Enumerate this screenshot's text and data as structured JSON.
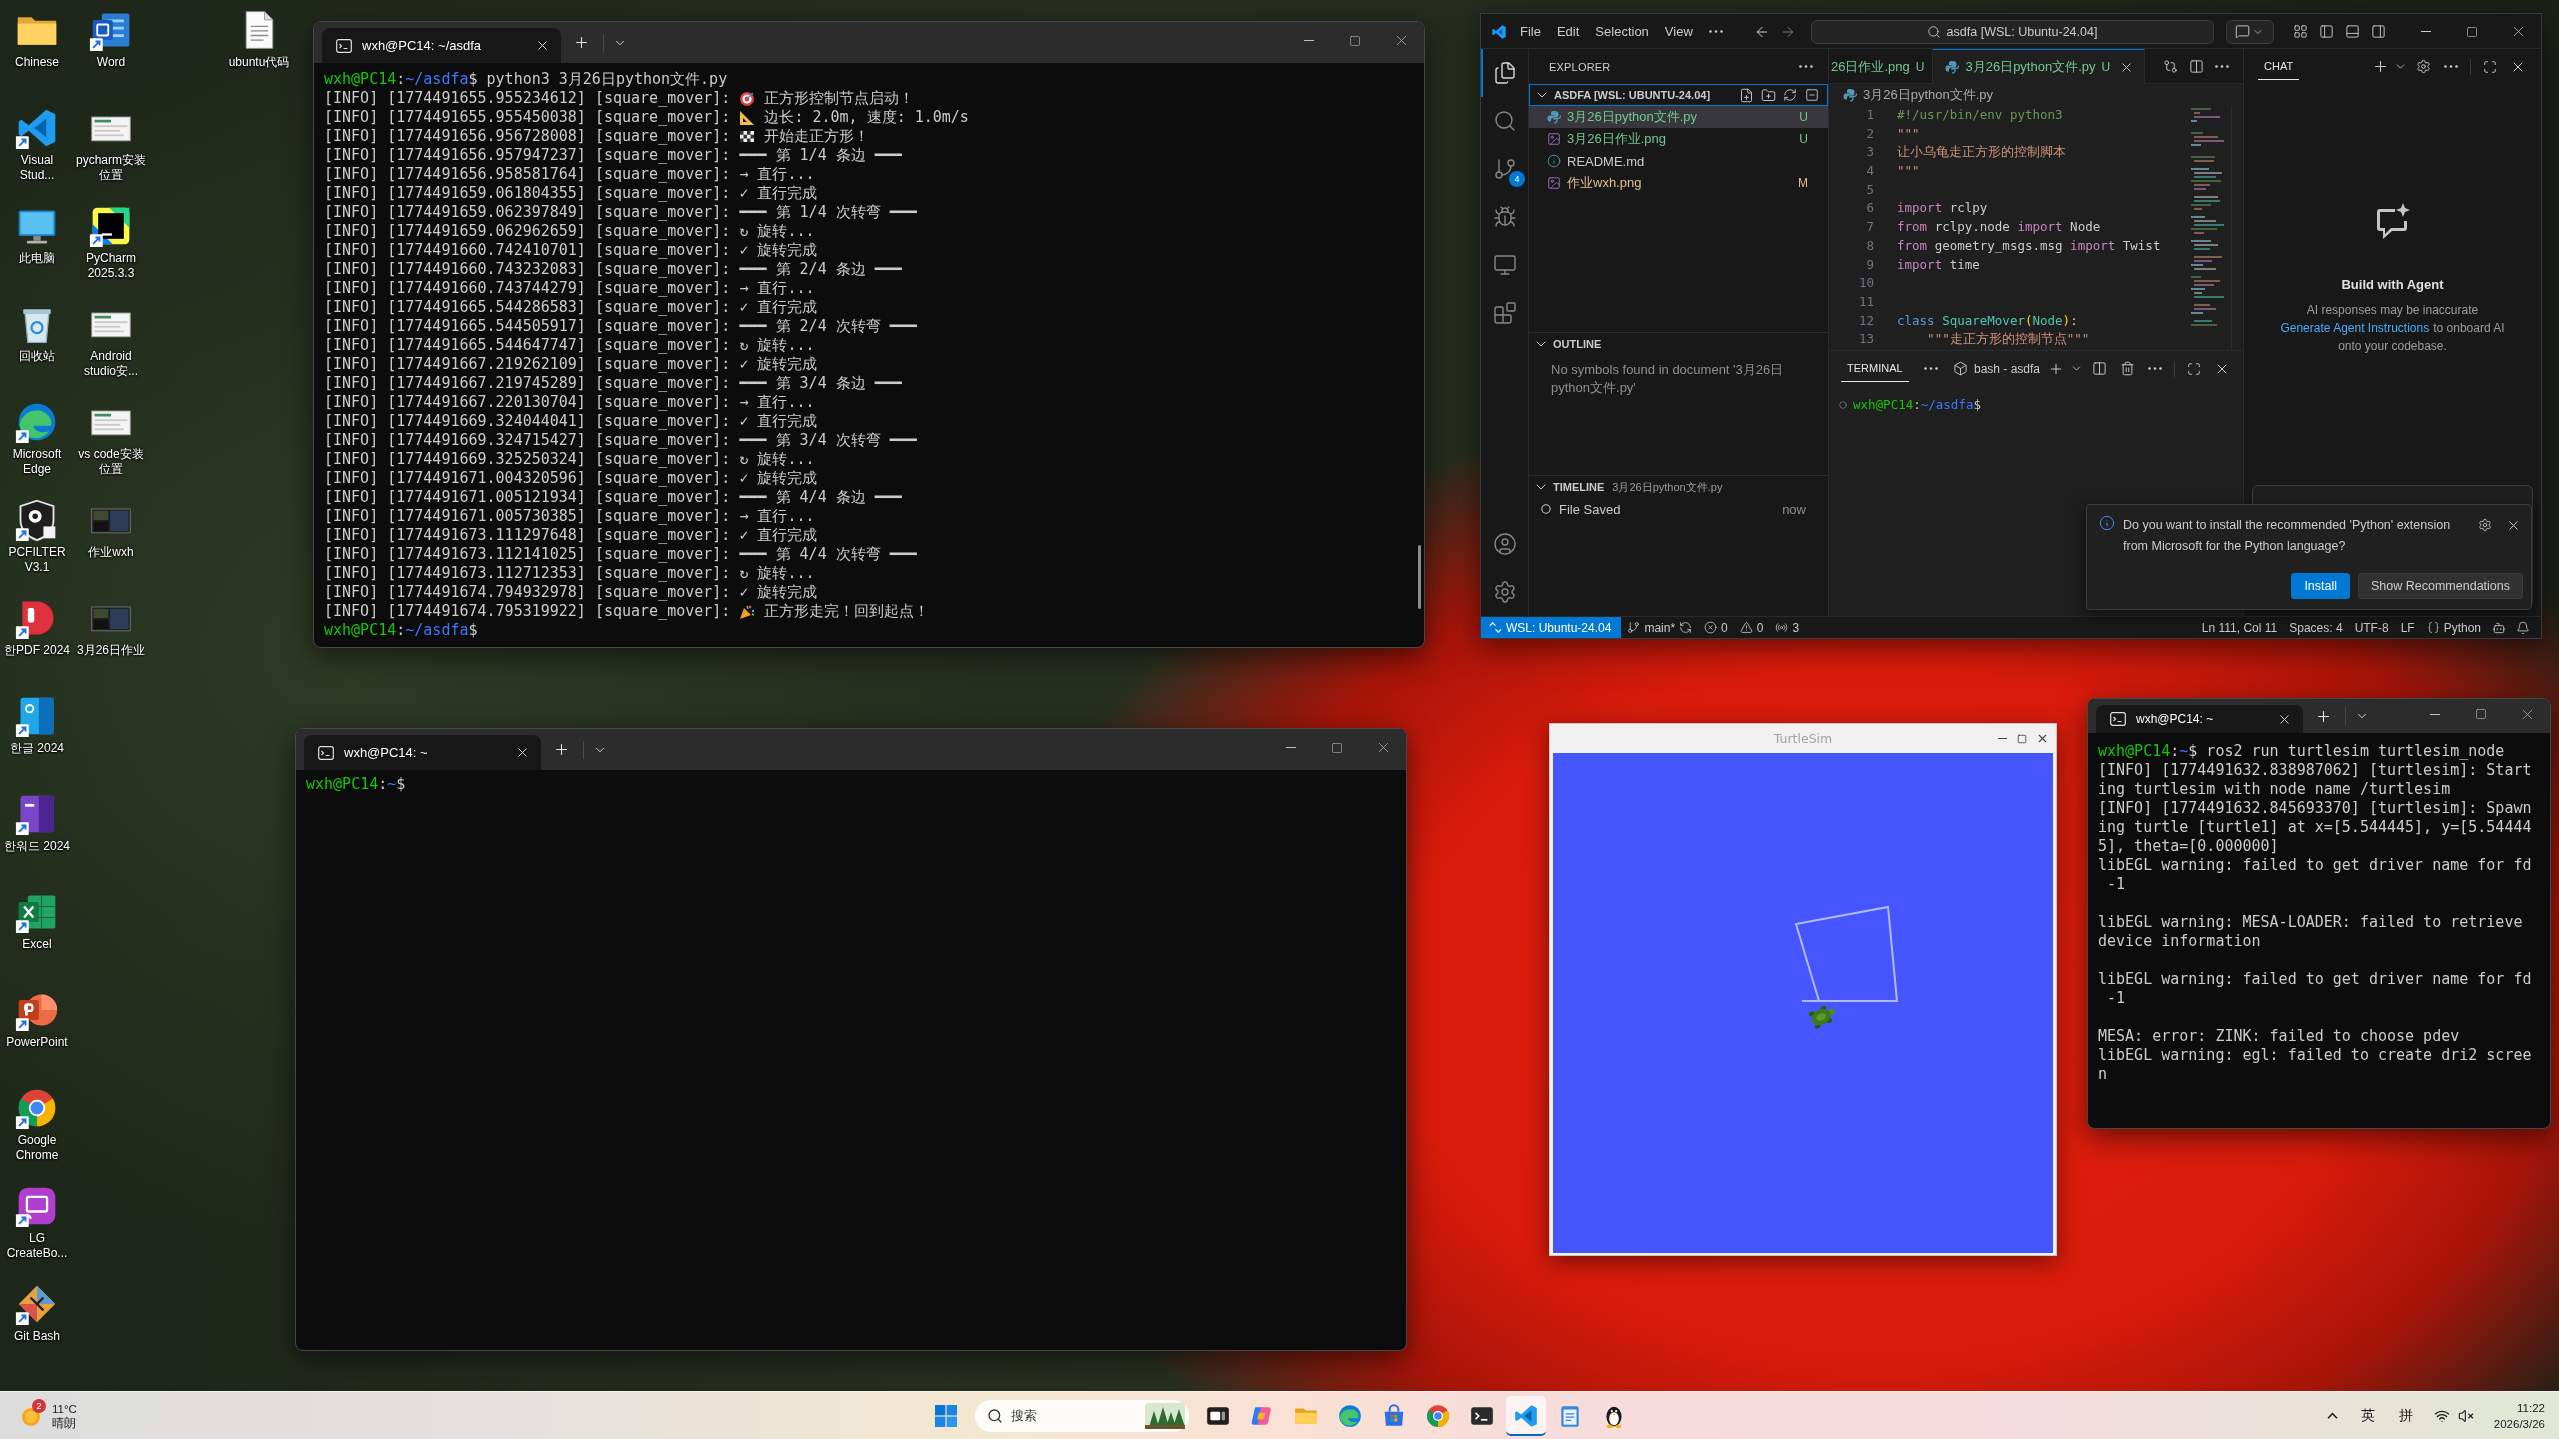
{
  "desktop": {
    "icon_columns": [
      {
        "icons": [
          {
            "kind": "folder",
            "label": "Chinese",
            "shortcut": false
          },
          {
            "kind": "vscode",
            "label": "Visual Stud...",
            "shortcut": true
          },
          {
            "kind": "monitor",
            "label": "此电脑",
            "shortcut": false
          },
          {
            "kind": "recycle_bin",
            "label": "回收站",
            "shortcut": false
          },
          {
            "kind": "edge",
            "label": "Microsoft Edge",
            "shortcut": true
          },
          {
            "kind": "shield",
            "label": "PCFILTER V3.1",
            "shortcut": true
          },
          {
            "kind": "pdf",
            "label": "한PDF 2024",
            "shortcut": true
          },
          {
            "kind": "hangul",
            "label": "한글 2024",
            "shortcut": true
          },
          {
            "kind": "hanword",
            "label": "한워드 2024",
            "shortcut": true
          },
          {
            "kind": "excel",
            "label": "Excel",
            "shortcut": true
          },
          {
            "kind": "powerpoint",
            "label": "PowerPoint",
            "shortcut": true
          },
          {
            "kind": "chrome",
            "label": "Google Chrome",
            "shortcut": true
          },
          {
            "kind": "cast",
            "label": "LG CreateBo...",
            "shortcut": true
          },
          {
            "kind": "git",
            "label": "Git Bash",
            "shortcut": true
          }
        ]
      },
      {
        "icons": [
          {
            "kind": "word",
            "label": "Word",
            "shortcut": true
          },
          {
            "kind": "thumbnail_light",
            "label": "pycharm安装位置",
            "shortcut": false
          },
          {
            "kind": "pycharm",
            "label": "PyCharm 2025.3.3",
            "shortcut": true
          },
          {
            "kind": "thumbnail_light",
            "label": "Android studio安...",
            "shortcut": false
          },
          {
            "kind": "thumbnail_light",
            "label": "vs code安装位置",
            "shortcut": false
          },
          {
            "kind": "thumbnail_dark",
            "label": "作业wxh",
            "shortcut": false
          },
          {
            "kind": "thumbnail_dark",
            "label": "3月26日作业",
            "shortcut": false
          }
        ]
      },
      {
        "icons": [
          {
            "kind": "document",
            "label": "ubuntu代码",
            "shortcut": false
          }
        ]
      }
    ]
  },
  "python_terminal": {
    "tab_title": "wxh@PC14: ~/asdfa",
    "blocks": [
      {
        "lines": [
          {
            "kind": "prompt",
            "prompt": [
              {
                "kind": "host",
                "text": "wxh@PC14"
              },
              {
                "kind": "sep",
                "text": ":"
              },
              {
                "kind": "path",
                "text": "~/asdfa"
              },
              {
                "kind": "sep",
                "text": "$"
              }
            ],
            "command": "python3 3月26日python文件.py"
          },
          {
            "kind": "target",
            "text": "[INFO] [1774491655.955234612] [square_mover]:",
            "message": "正方形控制节点启动！"
          },
          {
            "kind": "ruler",
            "text": "[INFO] [1774491655.955450038] [square_mover]:",
            "message": "边长: 2.0m, 速度: 1.0m/s"
          },
          {
            "kind": "flag",
            "text": "[INFO] [1774491656.956728008] [square_mover]:",
            "message": "开始走正方形！"
          },
          {
            "kind": "text",
            "text": "[INFO] [1774491656.957947237] [square_mover]: ━━━ 第 1/4 条边 ━━━"
          },
          {
            "kind": "text",
            "text": "[INFO] [1774491656.958581764] [square_mover]: → 直行..."
          },
          {
            "kind": "text",
            "text": "[INFO] [1774491659.061804355] [square_mover]: ✓ 直行完成"
          },
          {
            "kind": "text",
            "text": "[INFO] [1774491659.062397849] [square_mover]: ━━━ 第 1/4 次转弯 ━━━"
          },
          {
            "kind": "text",
            "text": "[INFO] [1774491659.062962659] [square_mover]: ↻ 旋转..."
          },
          {
            "kind": "text",
            "text": "[INFO] [1774491660.742410701] [square_mover]: ✓ 旋转完成"
          },
          {
            "kind": "text",
            "text": "[INFO] [1774491660.743232083] [square_mover]: ━━━ 第 2/4 条边 ━━━"
          },
          {
            "kind": "text",
            "text": "[INFO] [1774491660.743744279] [square_mover]: → 直行..."
          },
          {
            "kind": "text",
            "text": "[INFO] [1774491665.544286583] [square_mover]: ✓ 直行完成"
          },
          {
            "kind": "text",
            "text": "[INFO] [1774491665.544505917] [square_mover]: ━━━ 第 2/4 次转弯 ━━━"
          },
          {
            "kind": "text",
            "text": "[INFO] [1774491665.544647747] [square_mover]: ↻ 旋转..."
          },
          {
            "kind": "text",
            "text": "[INFO] [1774491667.219262109] [square_mover]: ✓ 旋转完成"
          },
          {
            "kind": "text",
            "text": "[INFO] [1774491667.219745289] [square_mover]: ━━━ 第 3/4 条边 ━━━"
          },
          {
            "kind": "text",
            "text": "[INFO] [1774491667.220130704] [square_mover]: → 直行..."
          },
          {
            "kind": "text",
            "text": "[INFO] [1774491669.324044041] [square_mover]: ✓ 直行完成"
          },
          {
            "kind": "text",
            "text": "[INFO] [1774491669.324715427] [square_mover]: ━━━ 第 3/4 次转弯 ━━━"
          },
          {
            "kind": "text",
            "text": "[INFO] [1774491669.325250324] [square_mover]: ↻ 旋转..."
          },
          {
            "kind": "text",
            "text": "[INFO] [1774491671.004320596] [square_mover]: ✓ 旋转完成"
          },
          {
            "kind": "text",
            "text": "[INFO] [1774491671.005121934] [square_mover]: ━━━ 第 4/4 条边 ━━━"
          },
          {
            "kind": "text",
            "text": "[INFO] [1774491671.005730385] [square_mover]: → 直行..."
          },
          {
            "kind": "text",
            "text": "[INFO] [1774491673.111297648] [square_mover]: ✓ 直行完成"
          },
          {
            "kind": "text",
            "text": "[INFO] [1774491673.112141025] [square_mover]: ━━━ 第 4/4 次转弯 ━━━"
          },
          {
            "kind": "text",
            "text": "[INFO] [1774491673.112712353] [square_mover]: ↻ 旋转..."
          },
          {
            "kind": "text",
            "text": "[INFO] [1774491674.794932978] [square_mover]: ✓ 旋转完成"
          },
          {
            "kind": "party",
            "text": "[INFO] [1774491674.795319922] [square_mover]:",
            "message": "正方形走完！回到起点！"
          },
          {
            "kind": "prompt",
            "prompt": [
              {
                "kind": "host",
                "text": "wxh@PC14"
              },
              {
                "kind": "sep",
                "text": ":"
              },
              {
                "kind": "path",
                "text": "~/asdfa"
              },
              {
                "kind": "sep",
                "text": "$"
              }
            ]
          }
        ]
      }
    ]
  },
  "vscode": {
    "menu": [
      "File",
      "Edit",
      "Selection",
      "View"
    ],
    "command_center": "asdfa [WSL: Ubuntu-24.04]",
    "activity_bar": [
      {
        "kind": "explorer",
        "selected": true
      },
      {
        "kind": "search",
        "selected": false
      },
      {
        "kind": "source_control",
        "selected": false,
        "badge": "4"
      },
      {
        "kind": "run",
        "selected": false
      },
      {
        "kind": "remote",
        "selected": false
      },
      {
        "kind": "extensions",
        "selected": false
      }
    ],
    "explorer": {
      "title": "EXPLORER",
      "folder": "ASDFA [WSL: UBUNTU-24.04]",
      "expanded": true,
      "files": [
        {
          "name": "3月26日python文件.py",
          "kind": "python",
          "color": "#73c991",
          "badge": "U",
          "selected": true
        },
        {
          "name": "3月26日作业.png",
          "kind": "image",
          "color": "#73c991",
          "badge": "U",
          "selected": false
        },
        {
          "name": "README.md",
          "kind": "info",
          "color": "#cccccc",
          "selected": false
        },
        {
          "name": "作业wxh.png",
          "kind": "image",
          "color": "#e2c08d",
          "badge": "M",
          "selected": false
        }
      ]
    },
    "outline": {
      "title": "OUTLINE",
      "expanded": true,
      "message": "No symbols found in document '3月26日python文件.py'"
    },
    "timeline": {
      "title": "TIMELINE",
      "file": "3月26日python文件.py",
      "expanded": true,
      "entries": [
        {
          "label": "File Saved",
          "time": "now"
        }
      ]
    },
    "tabs": [
      {
        "name": "26日作业.png",
        "color": "#73c991",
        "badge": "U",
        "selected": false
      },
      {
        "name": "3月26日python文件.py",
        "kind": "python",
        "color": "#73c991",
        "badge": "U",
        "selected": true
      }
    ],
    "breadcrumb": "3月26日python文件.py",
    "code": [
      {
        "number": "1",
        "tokens": [
          {
            "kind": "comment",
            "text": "#!/usr/bin/env python3"
          }
        ]
      },
      {
        "number": "2",
        "tokens": [
          {
            "kind": "string",
            "text": "\"\"\""
          }
        ]
      },
      {
        "number": "3",
        "tokens": [
          {
            "kind": "string",
            "text": "让小乌龟走正方形的控制脚本"
          }
        ]
      },
      {
        "number": "4",
        "tokens": [
          {
            "kind": "string",
            "text": "\"\"\""
          }
        ]
      },
      {
        "number": "5"
      },
      {
        "number": "6",
        "tokens": [
          {
            "kind": "keyword",
            "text": "import"
          },
          {
            "kind": "plain",
            "text": " rclpy"
          }
        ]
      },
      {
        "number": "7",
        "tokens": [
          {
            "kind": "keyword",
            "text": "from"
          },
          {
            "kind": "plain",
            "text": " rclpy.node "
          },
          {
            "kind": "keyword",
            "text": "import"
          },
          {
            "kind": "plain",
            "text": " Node"
          }
        ]
      },
      {
        "number": "8",
        "tokens": [
          {
            "kind": "keyword",
            "text": "from"
          },
          {
            "kind": "plain",
            "text": " geometry_msgs.msg "
          },
          {
            "kind": "keyword",
            "text": "import"
          },
          {
            "kind": "plain",
            "text": " Twist"
          }
        ]
      },
      {
        "number": "9",
        "tokens": [
          {
            "kind": "keyword",
            "text": "import"
          },
          {
            "kind": "plain",
            "text": " time"
          }
        ]
      },
      {
        "number": "10"
      },
      {
        "number": "11"
      },
      {
        "number": "12",
        "tokens": [
          {
            "kind": "storage",
            "text": "class"
          },
          {
            "kind": "type",
            "text": " SquareMover"
          },
          {
            "kind": "bracket",
            "text": "("
          },
          {
            "kind": "type",
            "text": "Node"
          },
          {
            "kind": "bracket",
            "text": ")"
          },
          {
            "kind": "plain",
            "text": ":"
          }
        ]
      },
      {
        "number": "13",
        "tokens": [
          {
            "kind": "string",
            "text": "    \"\"\"走正方形的控制节点\"\"\""
          }
        ]
      }
    ],
    "panel": {
      "tabs": [
        {
          "label": "TERMINAL",
          "selected": true
        }
      ],
      "terminal_name": "bash - asdfa",
      "prompt": [
        {
          "kind": "host",
          "text": "wxh@PC14"
        },
        {
          "kind": "sep",
          "text": ":"
        },
        {
          "kind": "path",
          "text": "~/asdfa"
        },
        {
          "kind": "sep",
          "text": "$"
        }
      ]
    },
    "chat": {
      "tabs": [
        {
          "label": "CHAT",
          "selected": true
        }
      ],
      "heading": "Build with Agent",
      "note": "AI responses may be inaccurate",
      "link": "Generate Agent Instructions",
      "note_end": "to onboard AI onto your codebase."
    },
    "notification": {
      "message": "Do you want to install the recommended 'Python' extension from Microsoft for the Python language?",
      "buttons": [
        {
          "label": "Install",
          "kind": "primary"
        },
        {
          "label": "Show Recommendations",
          "kind": "secondary"
        }
      ]
    },
    "status_bar": {
      "remote": "WSL: Ubuntu-24.04",
      "branch": "main*",
      "errors": "0",
      "warnings": "0",
      "ports": "3",
      "cursor": "Ln 111, Col 11",
      "indent": "Spaces: 4",
      "encoding": "UTF-8",
      "eol": "LF",
      "language": "Python"
    }
  },
  "empty_terminal": {
    "tab_title": "wxh@PC14: ~",
    "blocks": [
      {
        "lines": [
          {
            "kind": "prompt",
            "prompt": [
              {
                "kind": "host",
                "text": "wxh@PC14"
              },
              {
                "kind": "sep",
                "text": ":"
              },
              {
                "kind": "path",
                "text": "~"
              },
              {
                "kind": "sep",
                "text": "$"
              }
            ]
          }
        ]
      }
    ]
  },
  "turtlesim": {
    "title": "TurtleSim"
  },
  "turtlesim_terminal": {
    "tab_title": "wxh@PC14: ~",
    "blocks": [
      {
        "lines": [
          {
            "kind": "prompt",
            "prompt": [
              {
                "kind": "host",
                "text": "wxh@PC14"
              },
              {
                "kind": "sep",
                "text": ":"
              },
              {
                "kind": "path",
                "text": "~"
              },
              {
                "kind": "sep",
                "text": "$"
              }
            ],
            "command": "ros2 run turtlesim turtlesim_node"
          },
          {
            "kind": "text",
            "text": "[INFO] [1774491632.838987062] [turtlesim]: Start"
          },
          {
            "kind": "text",
            "text": "ing turtlesim with node name /turtlesim"
          },
          {
            "kind": "text",
            "text": "[INFO] [1774491632.845693370] [turtlesim]: Spawn"
          },
          {
            "kind": "text",
            "text": "ing turtle [turtle1] at x=[5.544445], y=[5.54444"
          },
          {
            "kind": "text",
            "text": "5], theta=[0.000000]"
          },
          {
            "kind": "text",
            "text": "libEGL warning: failed to get driver name for fd"
          },
          {
            "kind": "text",
            "text": " -1"
          }
        ]
      },
      {
        "lines": [
          {
            "kind": "text",
            "text": "libEGL warning: MESA-LOADER: failed to retrieve"
          },
          {
            "kind": "text",
            "text": "device information"
          }
        ]
      },
      {
        "lines": [
          {
            "kind": "text",
            "text": "libEGL warning: failed to get driver name for fd"
          },
          {
            "kind": "text",
            "text": " -1"
          }
        ]
      },
      {
        "lines": [
          {
            "kind": "text",
            "text": "MESA: error: ZINK: failed to choose pdev"
          },
          {
            "kind": "text",
            "text": "libEGL warning: egl: failed to create dri2 scree"
          },
          {
            "kind": "text",
            "text": "n"
          }
        ]
      }
    ]
  },
  "taskbar": {
    "weather": {
      "badge": "2",
      "temperature": "11°C",
      "condition": "晴朗"
    },
    "search": {
      "placeholder": "搜索"
    },
    "apps": [
      {
        "kind": "task_view",
        "active": false
      },
      {
        "kind": "copilot",
        "active": false
      },
      {
        "kind": "file_explorer",
        "active": false
      },
      {
        "kind": "edge",
        "active": false
      },
      {
        "kind": "store",
        "active": false
      },
      {
        "kind": "chrome",
        "active": false
      },
      {
        "kind": "terminal",
        "active": false
      },
      {
        "kind": "vscode",
        "active": true
      },
      {
        "kind": "notepad",
        "active": false
      },
      {
        "kind": "penguin",
        "active": false
      }
    ],
    "tray": {
      "input_mode": "英",
      "input_method": "拼"
    },
    "clock": {
      "time": "11:22",
      "date": "2026/3/26"
    }
  }
}
